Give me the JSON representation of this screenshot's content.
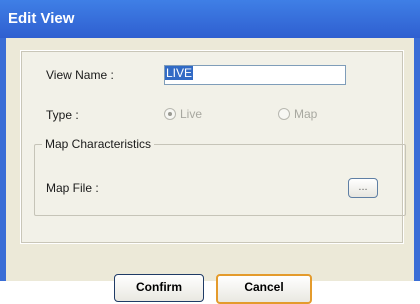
{
  "window": {
    "title": "Edit View"
  },
  "form": {
    "view_name_label": "View Name :",
    "view_name_value": "LIVE",
    "type_label": "Type :",
    "type_options": [
      "Live",
      "Map"
    ],
    "type_selected": "Live",
    "group_title": "Map Characteristics",
    "map_file_label": "Map File :",
    "browse_label": "..."
  },
  "buttons": {
    "confirm": "Confirm",
    "cancel": "Cancel"
  },
  "colors": {
    "titlebar": "#2f5fd0",
    "panel": "#f2f1e8",
    "highlight": "#316ac5",
    "cancel_border": "#e49b2c"
  }
}
